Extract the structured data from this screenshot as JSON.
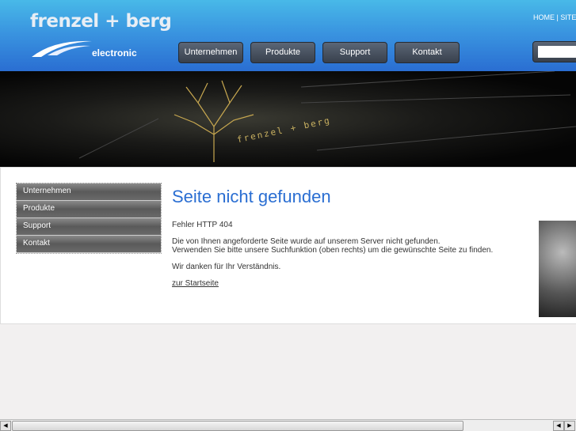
{
  "logo": {
    "name": "frenzel + berg",
    "sub": "electronic"
  },
  "top_links": "HOME | SITE",
  "top_nav": [
    "Unternehmen",
    "Produkte",
    "Support",
    "Kontakt"
  ],
  "banner_text": "frenzel + berg",
  "side_nav": [
    "Unternehmen",
    "Produkte",
    "Support",
    "Kontakt"
  ],
  "main": {
    "title": "Seite nicht gefunden",
    "error": "Fehler HTTP 404",
    "line1": "Die von Ihnen angeforderte Seite wurde auf unserem Server nicht gefunden.",
    "line2": "Verwenden Sie bitte unsere Suchfunktion (oben rechts) um die gewünschte Seite zu finden.",
    "thanks": "Wir danken für Ihr Verständnis.",
    "home_link": "zur Startseite"
  }
}
